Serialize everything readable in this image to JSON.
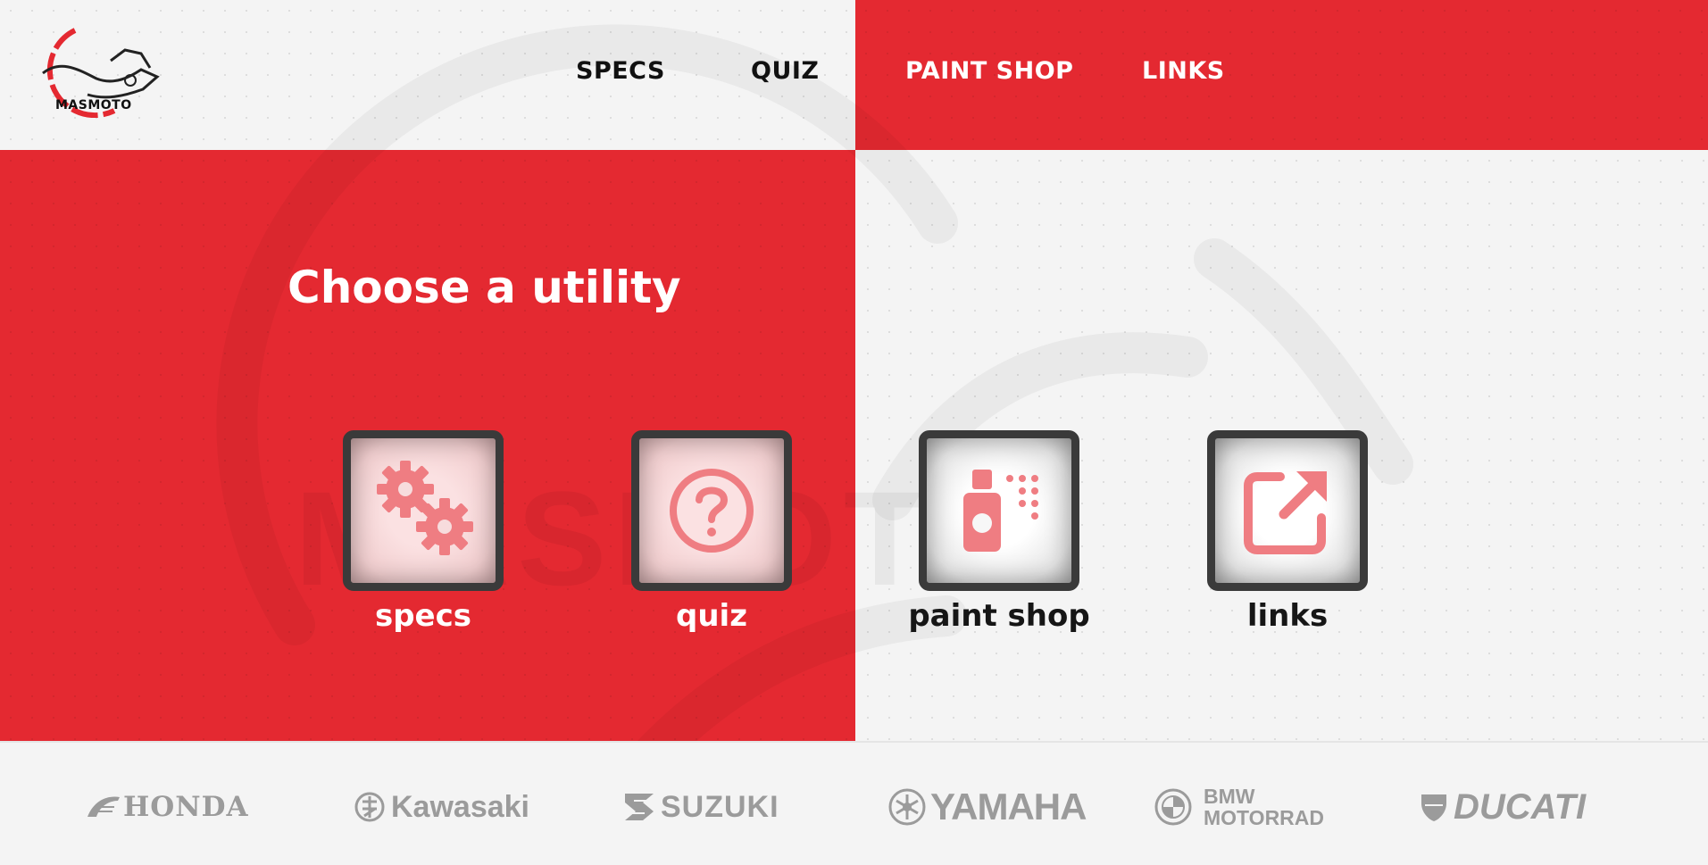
{
  "header": {
    "logo_text": "MASMOTO",
    "nav": [
      {
        "label": "SPECS"
      },
      {
        "label": "QUIZ"
      },
      {
        "label": "PAINT SHOP"
      },
      {
        "label": "LINKS"
      }
    ]
  },
  "main": {
    "headline": "Choose a utility",
    "background_wordmark": "MASMOTO",
    "tiles": [
      {
        "label": "specs",
        "icon": "gears-icon"
      },
      {
        "label": "quiz",
        "icon": "question-circle-icon"
      },
      {
        "label": "paint shop",
        "icon": "spray-can-icon"
      },
      {
        "label": "links",
        "icon": "external-link-icon"
      }
    ]
  },
  "footer": {
    "brands": [
      {
        "name": "HONDA",
        "icon": "honda-wing-icon"
      },
      {
        "name": "Kawasaki",
        "icon": "kawasaki-emblem-icon"
      },
      {
        "name": "SUZUKI",
        "icon": "suzuki-s-icon"
      },
      {
        "name": "YAMAHA",
        "icon": "yamaha-tuning-fork-icon"
      },
      {
        "name_line1": "BMW",
        "name_line2": "MOTORRAD",
        "icon": "bmw-roundel-icon"
      },
      {
        "name": "DUCATI",
        "icon": "ducati-shield-icon"
      }
    ]
  },
  "colors": {
    "brand_red": "#e42931",
    "light_bg": "#f4f4f4",
    "icon_pink": "#ef7d82",
    "tile_border": "#3a3a3a",
    "brand_gray": "#9b9b9b"
  }
}
